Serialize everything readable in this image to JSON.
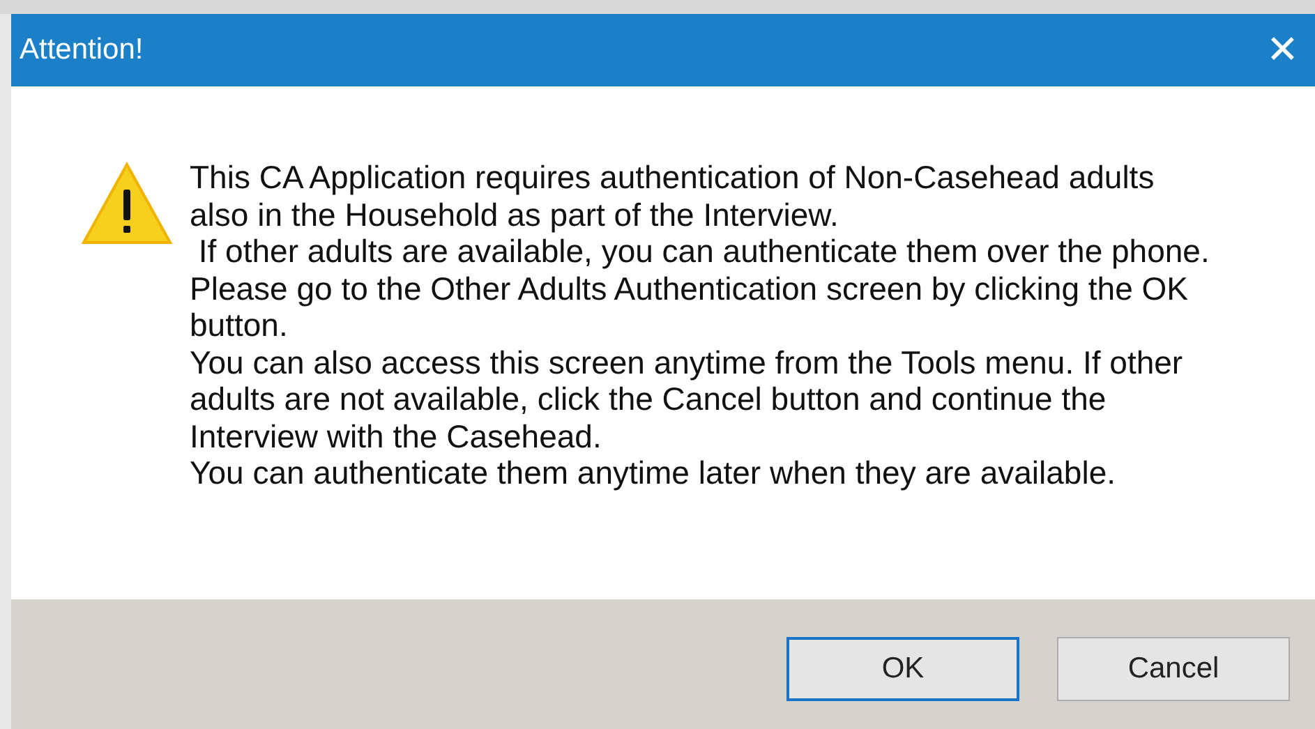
{
  "window": {
    "title": "Attention!",
    "close": "✕"
  },
  "message_lines": [
    "This CA Application requires authentication of Non-Casehead adults",
    "also in the Household as part of the Interview.",
    " If other adults are available, you can authenticate them over the phone.",
    "Please go to the Other Adults Authentication screen by clicking the OK",
    "button.",
    "You can also access this screen anytime from the Tools menu. If other",
    "adults are not available, click the Cancel button and continue the",
    "Interview with the Casehead.",
    "You can authenticate them anytime later when they are available."
  ],
  "buttons": [
    {
      "label": "OK",
      "selected": true
    },
    {
      "label": "Cancel",
      "selected": false
    }
  ]
}
